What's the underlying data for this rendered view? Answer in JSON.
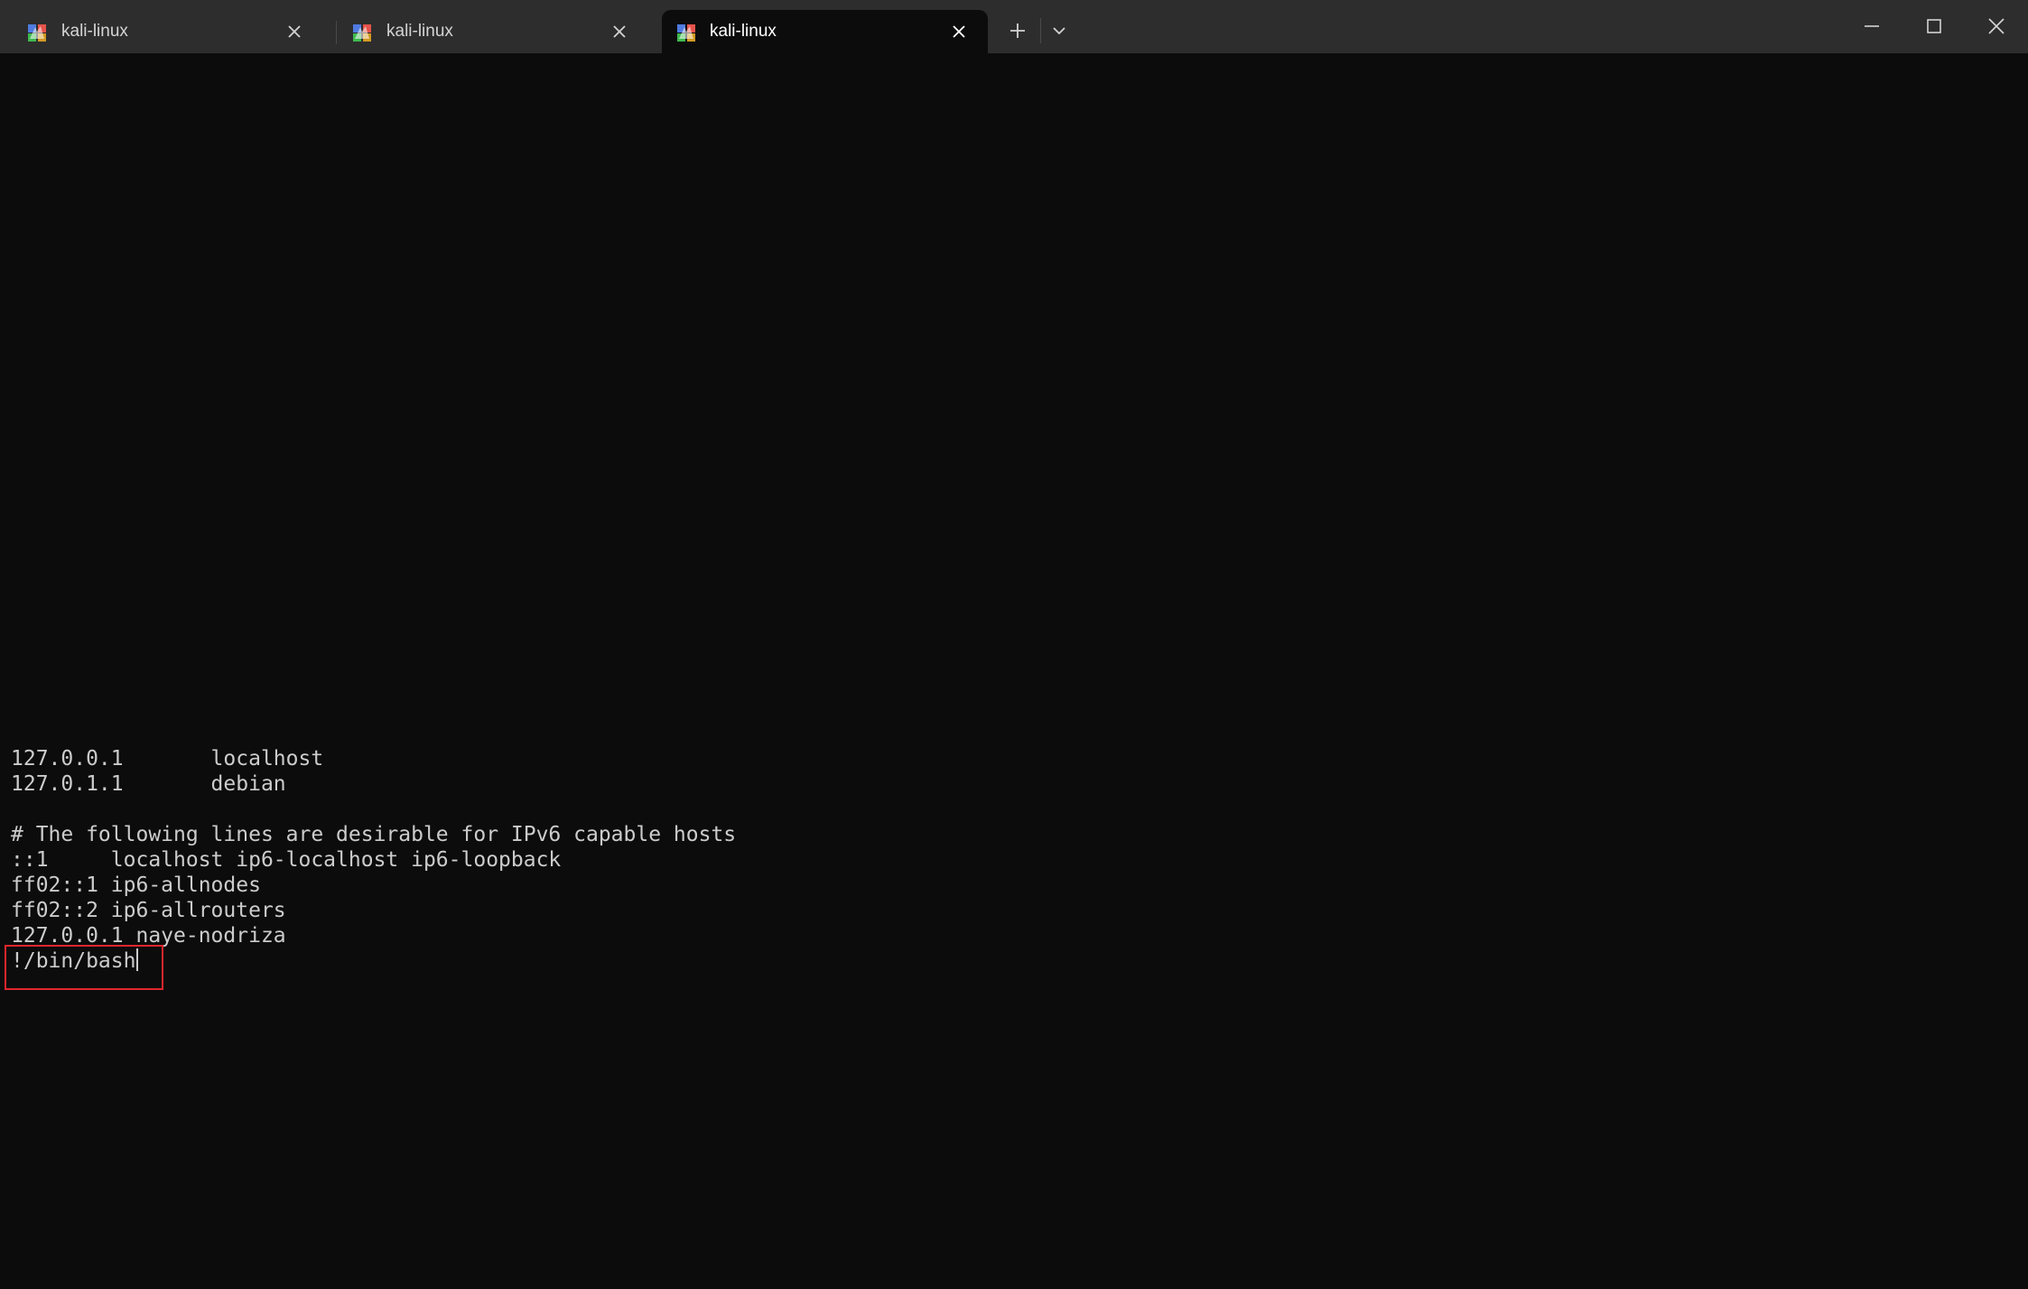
{
  "titlebar": {
    "tabs": [
      {
        "label": "kali-linux",
        "icon": "kali-linux-icon",
        "active": false
      },
      {
        "label": "kali-linux",
        "icon": "kali-linux-icon",
        "active": false
      },
      {
        "label": "kali-linux",
        "icon": "kali-linux-icon",
        "active": true
      }
    ],
    "new_tab_icon": "plus-icon",
    "dropdown_icon": "chevron-down-icon",
    "window_controls": [
      "minimize-icon",
      "maximize-icon",
      "close-icon"
    ]
  },
  "terminal": {
    "lines": [
      "127.0.0.1       localhost",
      "127.0.1.1       debian",
      "",
      "# The following lines are desirable for IPv6 capable hosts",
      "::1     localhost ip6-localhost ip6-loopback",
      "ff02::1 ip6-allnodes",
      "ff02::2 ip6-allrouters",
      "127.0.0.1 naye-nodriza"
    ],
    "prompt_input": "!/bin/bash"
  },
  "colors": {
    "titlebar_bg": "#2d2d2d",
    "terminal_bg": "#0c0c0c",
    "terminal_fg": "#cccccc",
    "highlight_border": "#e0262d"
  }
}
